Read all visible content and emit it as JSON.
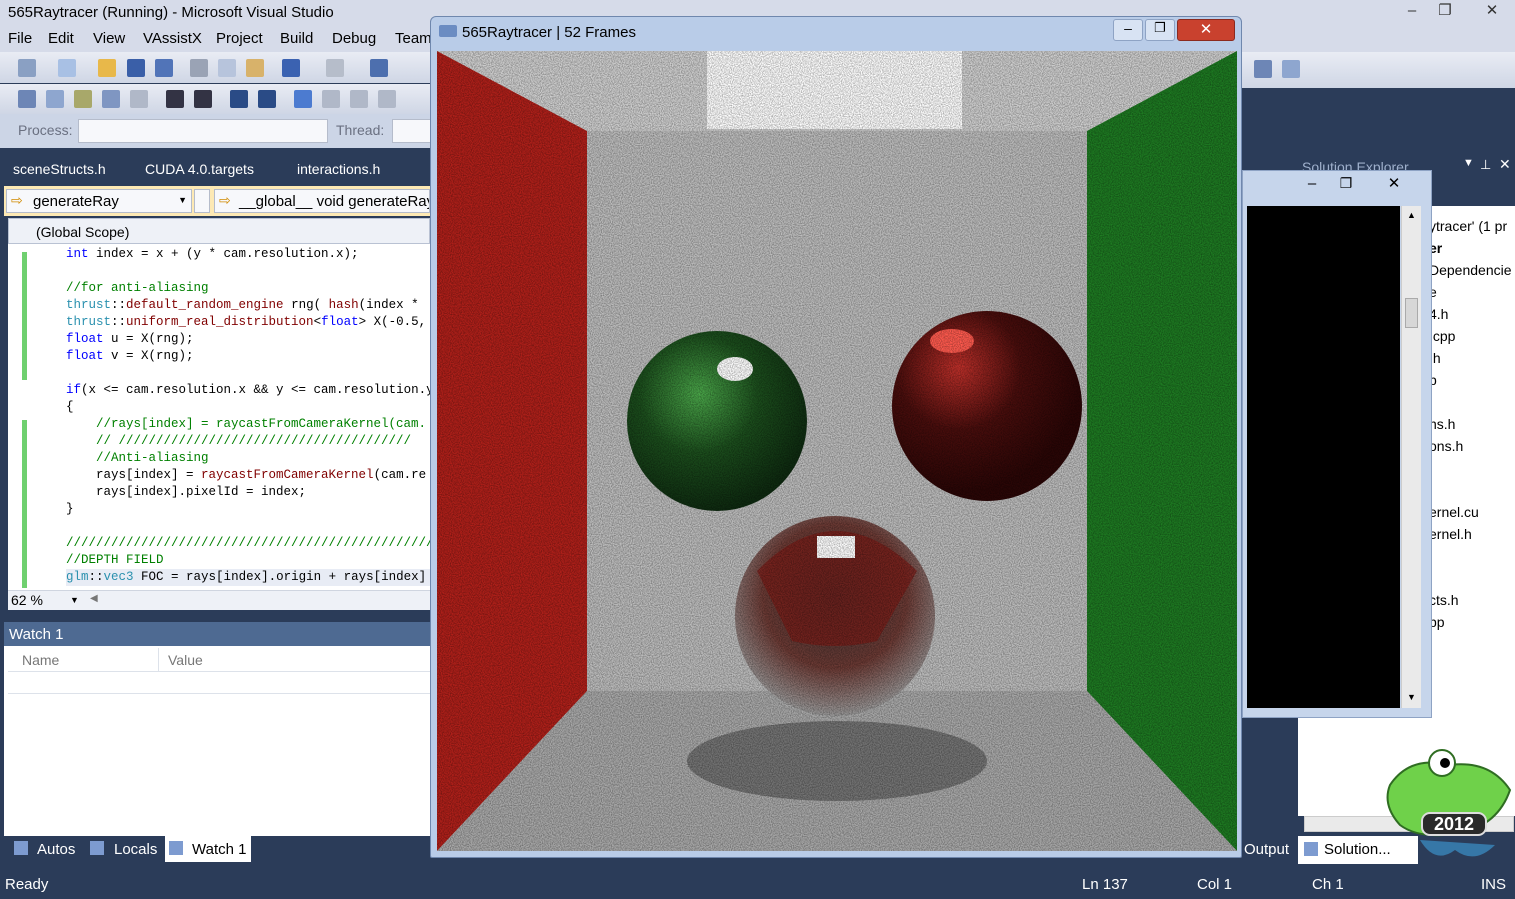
{
  "app": {
    "title": "565Raytracer (Running) - Microsoft Visual Studio",
    "menu": [
      "File",
      "Edit",
      "View",
      "VAssistX",
      "Project",
      "Build",
      "Debug",
      "Team"
    ],
    "process_label": "Process:",
    "thread_label": "Thread:"
  },
  "editor": {
    "tabs": [
      "sceneStructs.h",
      "CUDA 4.0.targets",
      "interactions.h"
    ],
    "nav_left": "generateRay",
    "nav_right": "__global__ void generateRay(",
    "scope": "(Global Scope)",
    "zoom": "62 %",
    "code_lines": [
      "int index = x + (y * cam.resolution.x);",
      "",
      "//for anti-aliasing",
      "thrust::default_random_engine rng( hash(index *",
      "thrust::uniform_real_distribution<float> X(-0.5,",
      "float u = X(rng);",
      "float v = X(rng);",
      "",
      "if(x <= cam.resolution.x && y <= cam.resolution.y",
      "{",
      "    //rays[index] = raycastFromCameraKernel(cam.",
      "    // ///////////////////////////////////////",
      "    //Anti-aliasing",
      "    rays[index] = raycastFromCameraKernel(cam.re",
      "    rays[index].pixelId = index;",
      "}",
      "",
      "///////////////////////////////////////////////////",
      "//DEPTH FIELD",
      "glm::vec3 FOC = rays[index].origin + rays[index]"
    ]
  },
  "watch": {
    "title": "Watch 1",
    "columns": [
      "Name",
      "Value"
    ],
    "bottom_tabs": [
      "Autos",
      "Locals",
      "Watch 1"
    ]
  },
  "status": {
    "ready": "Ready",
    "ln": "Ln 137",
    "col": "Col 1",
    "ch": "Ch 1",
    "ins": "INS"
  },
  "raytracer": {
    "title": "565Raytracer | 52 Frames"
  },
  "solution_explorer": {
    "title": "Solution Explorer",
    "items": [
      "ytracer' (1 pr",
      "er",
      "Dependencie",
      "e",
      "4.h",
      ".cpp",
      ".h",
      "p",
      "ns.h",
      "ons.h",
      "ernel.cu",
      "ernel.h",
      "cts.h",
      "pp"
    ],
    "bottom_tabs": [
      "Output",
      "Solution..."
    ]
  },
  "mascot": {
    "badge": "2012"
  },
  "colors": {
    "vs_blue": "#2b3c59",
    "wall_red": "#b0201a",
    "wall_green": "#1e7a22",
    "close_red": "#c9412e"
  }
}
